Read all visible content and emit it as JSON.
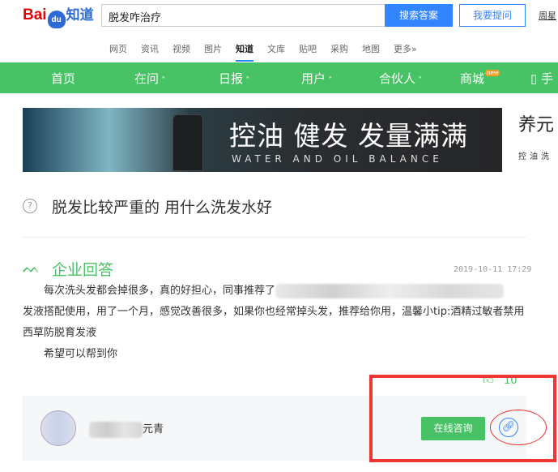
{
  "header": {
    "logo": "Bai du 知道",
    "logo_bai": "Bai",
    "logo_du": "du",
    "logo_zhidao": "知道",
    "search_value": "脱发咋治疗",
    "search_button": "搜索答案",
    "ask_button": "我要提问",
    "user": "周星"
  },
  "tabs": [
    {
      "label": "网页"
    },
    {
      "label": "资讯"
    },
    {
      "label": "视频"
    },
    {
      "label": "图片"
    },
    {
      "label": "知道",
      "active": true
    },
    {
      "label": "文库"
    },
    {
      "label": "贴吧"
    },
    {
      "label": "采购"
    },
    {
      "label": "地图"
    },
    {
      "label": "更多»"
    }
  ],
  "nav": {
    "items": [
      "首页",
      "在问",
      "日报",
      "用户",
      "合伙人",
      "商城",
      "手"
    ],
    "new_badge": "new",
    "accent": "#47c264"
  },
  "banner": {
    "title": "控油 健发 发量满满",
    "subtitle": "WATER AND OIL BALANCE",
    "brand": "养元",
    "brand_sub": "控油洗"
  },
  "question": {
    "title": "脱发比较严重的 用什么洗发水好"
  },
  "answer": {
    "label": "企业回答",
    "date": "2019-10-11 17:29",
    "line1": "每次洗头发都会掉很多，真的好担心，同事推荐了",
    "line2": "发液搭配使用，用了一个月，感觉改善很多，如果你也经常掉头发，推荐给你用，温馨小tip:酒精过敏者禁用西草防脱育发液",
    "line3": "希望可以帮到你",
    "likes": "10"
  },
  "card": {
    "name_suffix": "元青",
    "consult_button": "在线咨询"
  }
}
